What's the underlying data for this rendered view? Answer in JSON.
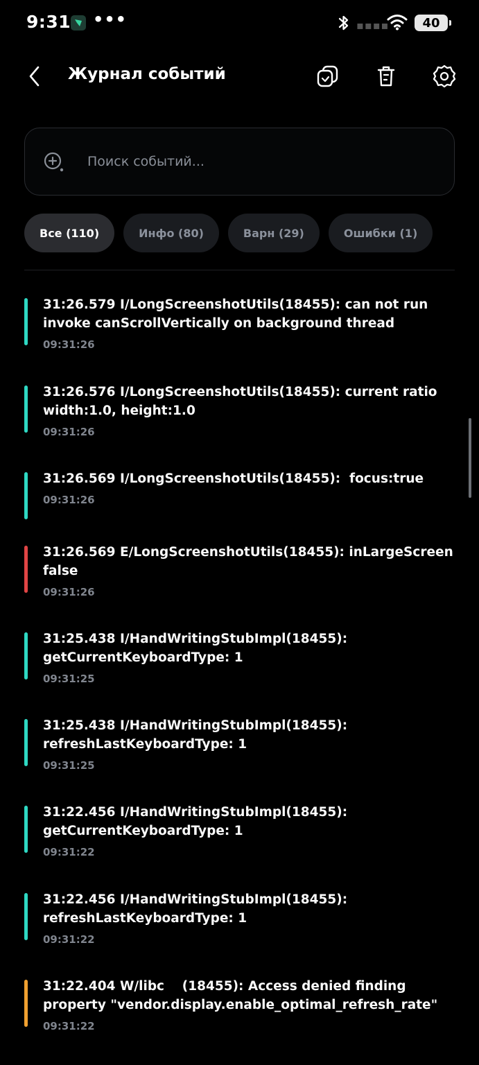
{
  "status_bar": {
    "time": "9:31",
    "dots": "•••",
    "battery": "40",
    "icons": [
      "app-badge-icon",
      "bluetooth-icon",
      "signal-icon",
      "wifi-icon",
      "battery-icon"
    ]
  },
  "header": {
    "title": "Журнал событий",
    "icons": [
      "back-icon",
      "copy-icon",
      "trash-icon",
      "gear-icon"
    ]
  },
  "search": {
    "placeholder": "Поиск событий...",
    "value": ""
  },
  "filters": [
    {
      "label": "Все (110)",
      "active": true
    },
    {
      "label": "Инфо (80)",
      "active": false
    },
    {
      "label": "Варн (29)",
      "active": false
    },
    {
      "label": "Ошибки (1)",
      "active": false
    }
  ],
  "level_colors": {
    "info": "#2ed8c3",
    "error": "#e04545",
    "warn": "#f0a030"
  },
  "logs": [
    {
      "level": "info",
      "message": "31:26.579 I/LongScreenshotUtils(18455): can not run invoke canScrollVertically on background thread",
      "time": "09:31:26"
    },
    {
      "level": "info",
      "message": "31:26.576 I/LongScreenshotUtils(18455): current ratio width:1.0, height:1.0",
      "time": "09:31:26"
    },
    {
      "level": "info",
      "message": "31:26.569 I/LongScreenshotUtils(18455):  focus:true",
      "time": "09:31:26"
    },
    {
      "level": "error",
      "message": "31:26.569 E/LongScreenshotUtils(18455): inLargeScreen false",
      "time": "09:31:26"
    },
    {
      "level": "info",
      "message": "31:25.438 I/HandWritingStubImpl(18455): getCurrentKeyboardType: 1",
      "time": "09:31:25"
    },
    {
      "level": "info",
      "message": "31:25.438 I/HandWritingStubImpl(18455): refreshLastKeyboardType: 1",
      "time": "09:31:25"
    },
    {
      "level": "info",
      "message": "31:22.456 I/HandWritingStubImpl(18455): getCurrentKeyboardType: 1",
      "time": "09:31:22"
    },
    {
      "level": "info",
      "message": "31:22.456 I/HandWritingStubImpl(18455): refreshLastKeyboardType: 1",
      "time": "09:31:22"
    },
    {
      "level": "warn",
      "message": "31:22.404 W/libc    (18455): Access denied finding property \"vendor.display.enable_optimal_refresh_rate\"",
      "time": "09:31:22"
    }
  ]
}
